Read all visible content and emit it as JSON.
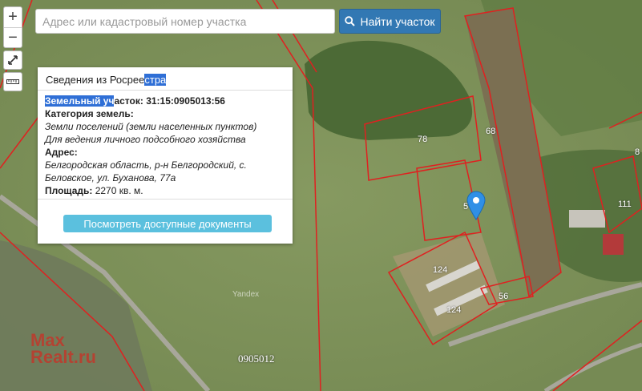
{
  "search": {
    "placeholder": "Адрес или кадастровый номер участка",
    "button_label": "Найти участок"
  },
  "controls": {
    "zoom_in": "+",
    "zoom_out": "−"
  },
  "popup": {
    "title_pre": "Сведения из Росрее",
    "title_hl": "стра",
    "plot_label_hl": "Земельный уч",
    "plot_label_rest": "асток:",
    "cadastral_number": "31:15:0905013:56",
    "category_label": "Категория земель:",
    "category_value": "Земли поселений (земли населенных пунктов)",
    "use_value": "Для ведения личного подсобного хозяйства",
    "address_label": "Адрес:",
    "address_line1": "Белгородская область, р-н Белгородский, с.",
    "address_line2": "Беловское, ул. Буханова, 77а",
    "area_label": "Площадь:",
    "area_value": "2270 кв. м.",
    "docs_button": "Посмотреть доступные документы"
  },
  "map": {
    "plot_labels": [
      "78",
      "68",
      "5",
      "124",
      "124",
      "56",
      "111",
      "8"
    ],
    "quarter": "0905012",
    "provider": "Yandex",
    "colors": {
      "boundary": "#e02020",
      "field": "#7a8f52",
      "forest": "#4c6a36",
      "marker": "#2f8fe6"
    }
  },
  "watermark": {
    "line1": "Max",
    "line2": "Realt.ru"
  }
}
